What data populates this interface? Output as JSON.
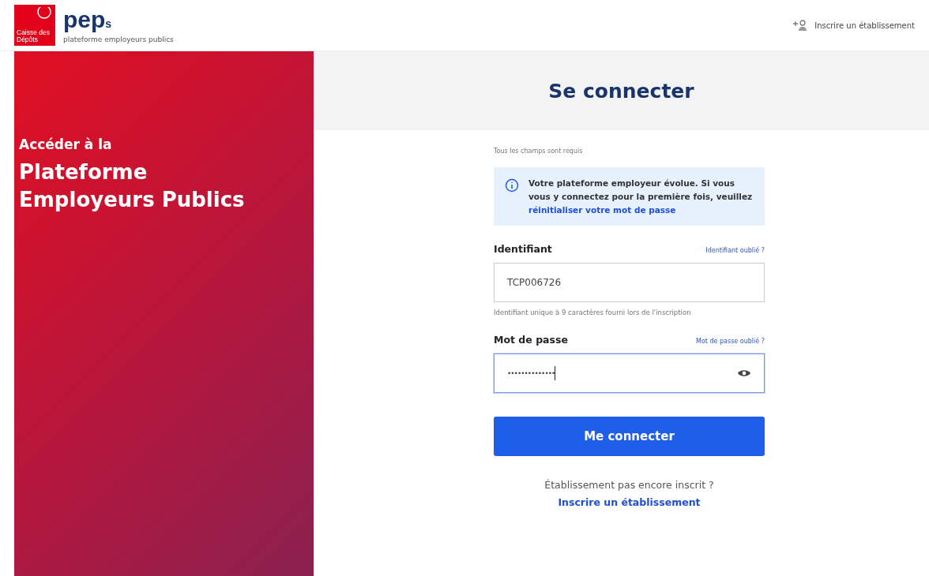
{
  "header": {
    "logo_caption": "Caisse des Dépôts",
    "brand": "pep",
    "brand_suffix": "s",
    "tagline": "plateforme employeurs publics",
    "register_link": "Inscrire un établissement"
  },
  "hero": {
    "intro": "Accéder à la",
    "title": "Plateforme Employeurs Publics"
  },
  "form": {
    "title": "Se connecter",
    "required_note": "Tous les champs sont requis",
    "notice": {
      "text": "Votre plateforme employeur évolue. Si vous vous y connectez pour la première fois, veuillez ",
      "link": "réinitialiser votre mot de passe"
    },
    "fields": [
      {
        "kind": "text",
        "label": "Identifiant",
        "help_link": "Identifiant oublié ?",
        "value": "TCP006726",
        "hint": "Identifiant unique à 9 caractères fourni lors de l'inscription",
        "focused": false
      },
      {
        "kind": "password",
        "label": "Mot de passe",
        "help_link": "Mot de passe oublié ?",
        "value": "••••••••••••••",
        "focused": true
      }
    ],
    "submit": "Me connecter",
    "footer": {
      "text": "Établissement pas encore inscrit ?",
      "link": "Inscrire un établissement"
    }
  }
}
